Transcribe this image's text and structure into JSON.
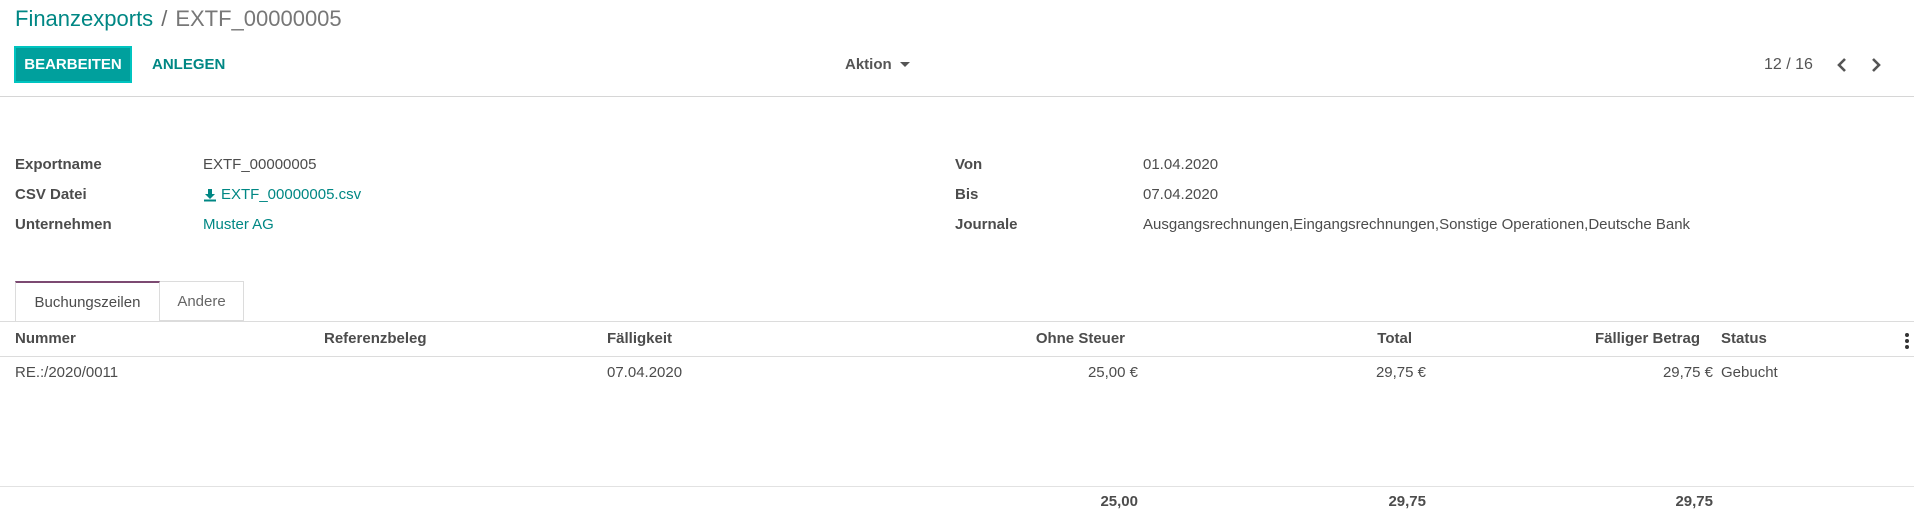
{
  "breadcrumb": {
    "parent": "Finanzexports",
    "separator": "/",
    "current": "EXTF_00000005"
  },
  "toolbar": {
    "edit_label": "BEARBEITEN",
    "create_label": "ANLEGEN",
    "action_label": "Aktion",
    "pager": "12 / 16"
  },
  "form": {
    "left": [
      {
        "label": "Exportname",
        "value": "EXTF_00000005"
      },
      {
        "label": "CSV Datei",
        "value": "EXTF_00000005.csv"
      },
      {
        "label": "Unternehmen",
        "value": "Muster AG"
      }
    ],
    "right": [
      {
        "label": "Von",
        "value": "01.04.2020"
      },
      {
        "label": "Bis",
        "value": "07.04.2020"
      },
      {
        "label": "Journale",
        "value": "Ausgangsrechnungen,Eingangsrechnungen,Sonstige Operationen,Deutsche Bank"
      }
    ]
  },
  "tabs": [
    {
      "label": "Buchungszeilen",
      "active": true
    },
    {
      "label": "Andere",
      "active": false
    }
  ],
  "table": {
    "columns": [
      "Nummer",
      "Referenzbeleg",
      "Fälligkeit",
      "Ohne Steuer",
      "Total",
      "Fälliger Betrag",
      "Status"
    ],
    "rows": [
      [
        "RE.:/2020/0011",
        "",
        "07.04.2020",
        "25,00 €",
        "29,75 €",
        "29,75 €",
        "Gebucht"
      ]
    ],
    "totals": {
      "ohne_steuer": "25,00",
      "total": "29,75",
      "faelliger_betrag": "29,75"
    }
  },
  "colors": {
    "accent": "#00a09d",
    "link": "#008784",
    "tab_active": "#7c4a72"
  },
  "icons": {
    "download": "download-icon",
    "prev": "chevron-left-icon",
    "next": "chevron-right-icon",
    "more": "kebab-menu-icon"
  }
}
